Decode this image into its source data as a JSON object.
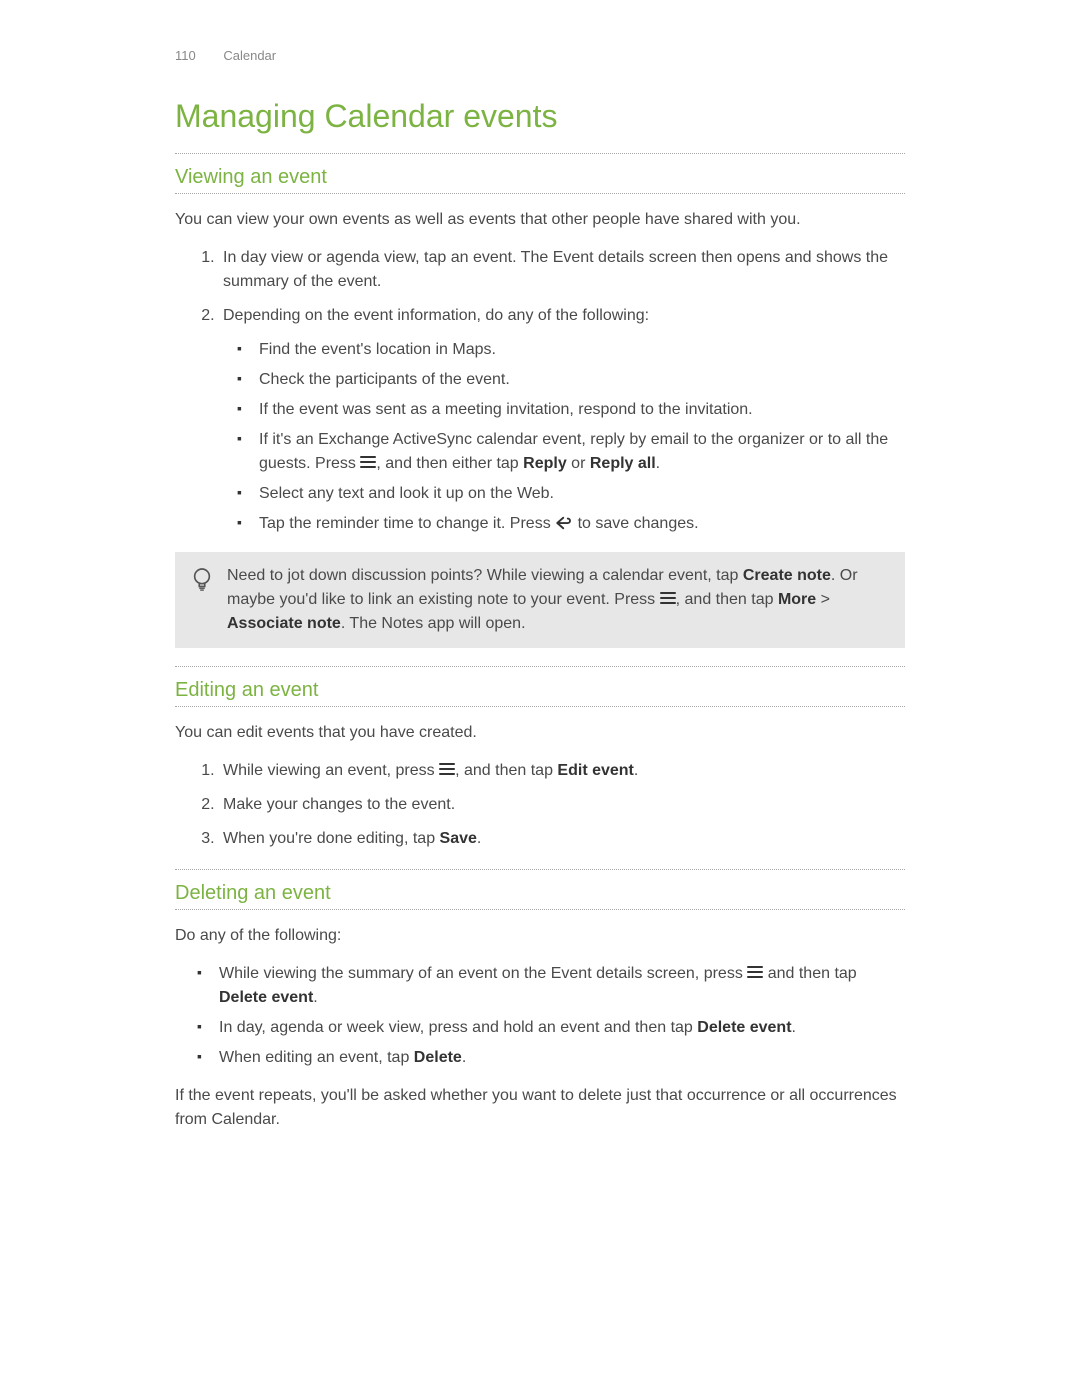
{
  "header": {
    "page_num": "110",
    "section": "Calendar"
  },
  "title": "Managing Calendar events",
  "viewing": {
    "heading": "Viewing an event",
    "intro": "You can view your own events as well as events that other people have shared with you.",
    "step1": "In day view or agenda view, tap an event. The Event details screen then opens and shows the summary of the event.",
    "step2": "Depending on the event information, do any of the following:",
    "bullets": {
      "b1": "Find the event's location in Maps.",
      "b2": "Check the participants of the event.",
      "b3": "If the event was sent as a meeting invitation, respond to the invitation.",
      "b4a": "If it's an Exchange ActiveSync calendar event, reply by email to the organizer or to all the guests. Press ",
      "b4b": ", and then either tap ",
      "b4_reply": "Reply",
      "b4c": " or ",
      "b4_replyall": "Reply all",
      "b4d": ".",
      "b5": "Select any text and look it up on the Web.",
      "b6a": "Tap the reminder time to change it. Press ",
      "b6b": " to save changes."
    }
  },
  "callout": {
    "t1": "Need to jot down discussion points? While viewing a calendar event, tap ",
    "create_note": "Create note",
    "t2": ". Or maybe you'd like to link an existing note to your event. Press ",
    "t3": ", and then tap ",
    "more": "More",
    "gt": " > ",
    "assoc": "Associate note",
    "t4": ". The Notes app will open."
  },
  "editing": {
    "heading": "Editing an event",
    "intro": "You can edit events that you have created.",
    "s1a": "While viewing an event, press ",
    "s1b": ", and then tap ",
    "s1_edit": "Edit event",
    "s1c": ".",
    "s2": "Make your changes to the event.",
    "s3a": "When you're done editing, tap ",
    "s3_save": "Save",
    "s3b": "."
  },
  "deleting": {
    "heading": "Deleting an event",
    "intro": "Do any of the following:",
    "b1a": "While viewing the summary of an event on the Event details screen, press ",
    "b1b": " and then tap ",
    "b1_del": "Delete event",
    "b1c": ".",
    "b2a": "In day, agenda or week view, press and hold an event and then tap ",
    "b2_del": "Delete event",
    "b2b": ".",
    "b3a": "When editing an event, tap ",
    "b3_del": "Delete",
    "b3b": ".",
    "outro": "If the event repeats, you'll be asked whether you want to delete just that occurrence or all occurrences from Calendar."
  }
}
